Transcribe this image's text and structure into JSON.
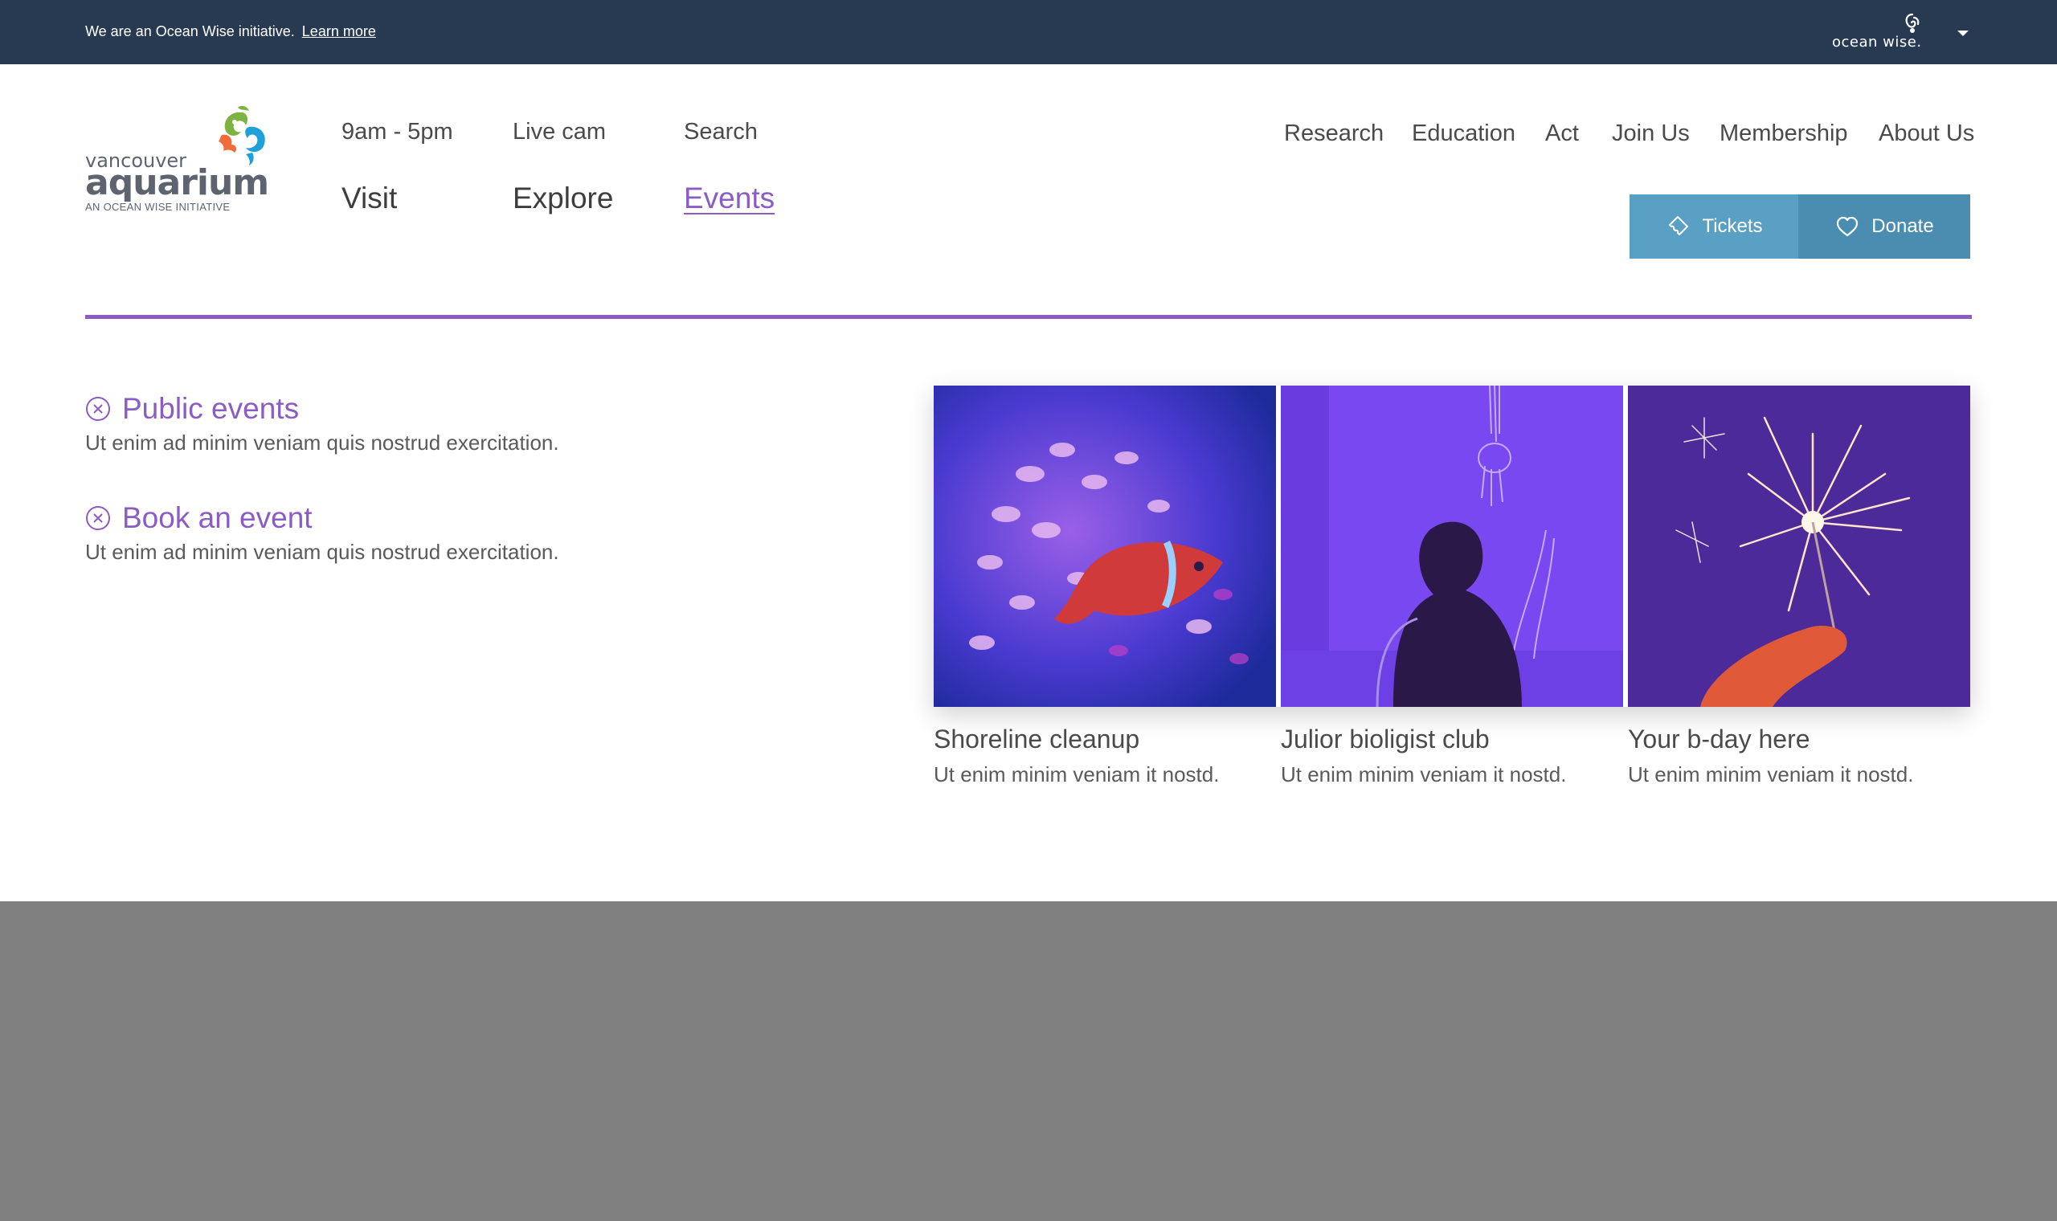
{
  "topbar": {
    "note": "We are an Ocean Wise initiative.",
    "link": "Learn more",
    "brand": "ocean wise."
  },
  "logo": {
    "line1": "vancouver",
    "line2": "aquarium",
    "line3": "AN OCEAN WISE INITIATIVE"
  },
  "nav": {
    "hours": "9am - 5pm",
    "livecam": "Live cam",
    "search": "Search",
    "visit": "Visit",
    "explore": "Explore",
    "events": "Events",
    "right": [
      "Research",
      "Education",
      "Act",
      "Join Us",
      "Membership",
      "About Us"
    ]
  },
  "actions": {
    "tickets": "Tickets",
    "donate": "Donate"
  },
  "colors": {
    "accent": "#8a5cc4",
    "topbar": "#273a52",
    "tickets": "#5a9fc4",
    "donate": "#4a8db1",
    "footer": "#808080"
  },
  "items": [
    {
      "title": "Public events",
      "desc": "Ut enim ad minim veniam quis nostrud exercitation.",
      "icon": "close-circle-icon"
    },
    {
      "title": "Book an event",
      "desc": "Ut enim ad minim veniam quis nostrud exercitation.",
      "icon": "close-circle-icon"
    }
  ],
  "cards": [
    {
      "title": "Shoreline cleanup",
      "desc": "Ut enim minim veniam it nostd."
    },
    {
      "title": "Julior bioligist club",
      "desc": "Ut enim minim veniam it nostd."
    },
    {
      "title": "Your b-day here",
      "desc": "Ut enim minim veniam it nostd."
    }
  ]
}
